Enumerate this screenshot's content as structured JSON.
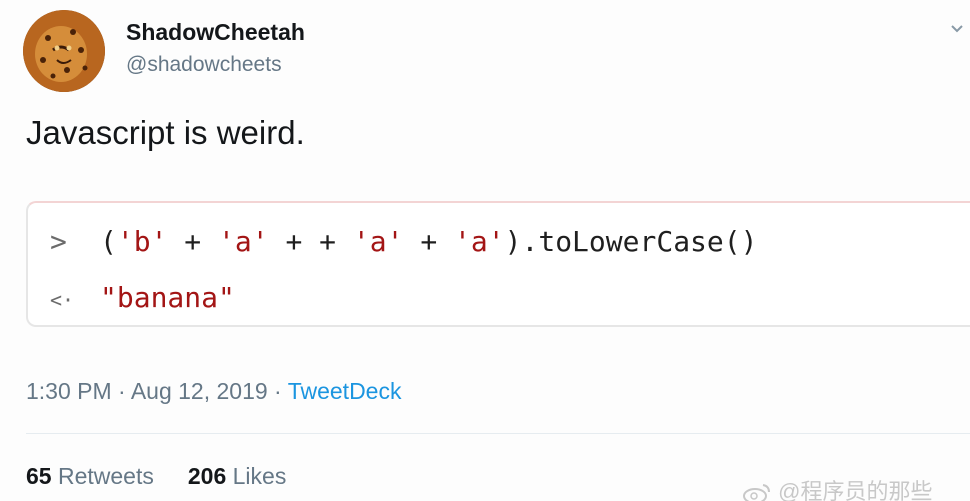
{
  "author": {
    "display_name": "ShadowCheetah",
    "handle": "@shadowcheets",
    "avatar_icon": "cheetah-avatar"
  },
  "tweet": {
    "text": "Javascript is weird."
  },
  "console": {
    "input_prompt": ">",
    "input_code_prefix": "(",
    "input_code_parts": [
      "'b'",
      " + ",
      "'a'",
      " + + ",
      "'a'",
      " + ",
      "'a'",
      ").toLowerCase()"
    ],
    "output_prompt": "<·",
    "output_value": "\"banana\""
  },
  "meta": {
    "time": "1:30 PM",
    "separator": " · ",
    "date": "Aug 12, 2019",
    "source": "TweetDeck"
  },
  "stats": {
    "retweets_count": "65",
    "retweets_label": " Retweets",
    "likes_count": "206",
    "likes_label": " Likes"
  },
  "watermark": {
    "text": "@程序员的那些"
  },
  "colors": {
    "link": "#1b95e0",
    "muted": "#657786",
    "string": "#a31515"
  }
}
